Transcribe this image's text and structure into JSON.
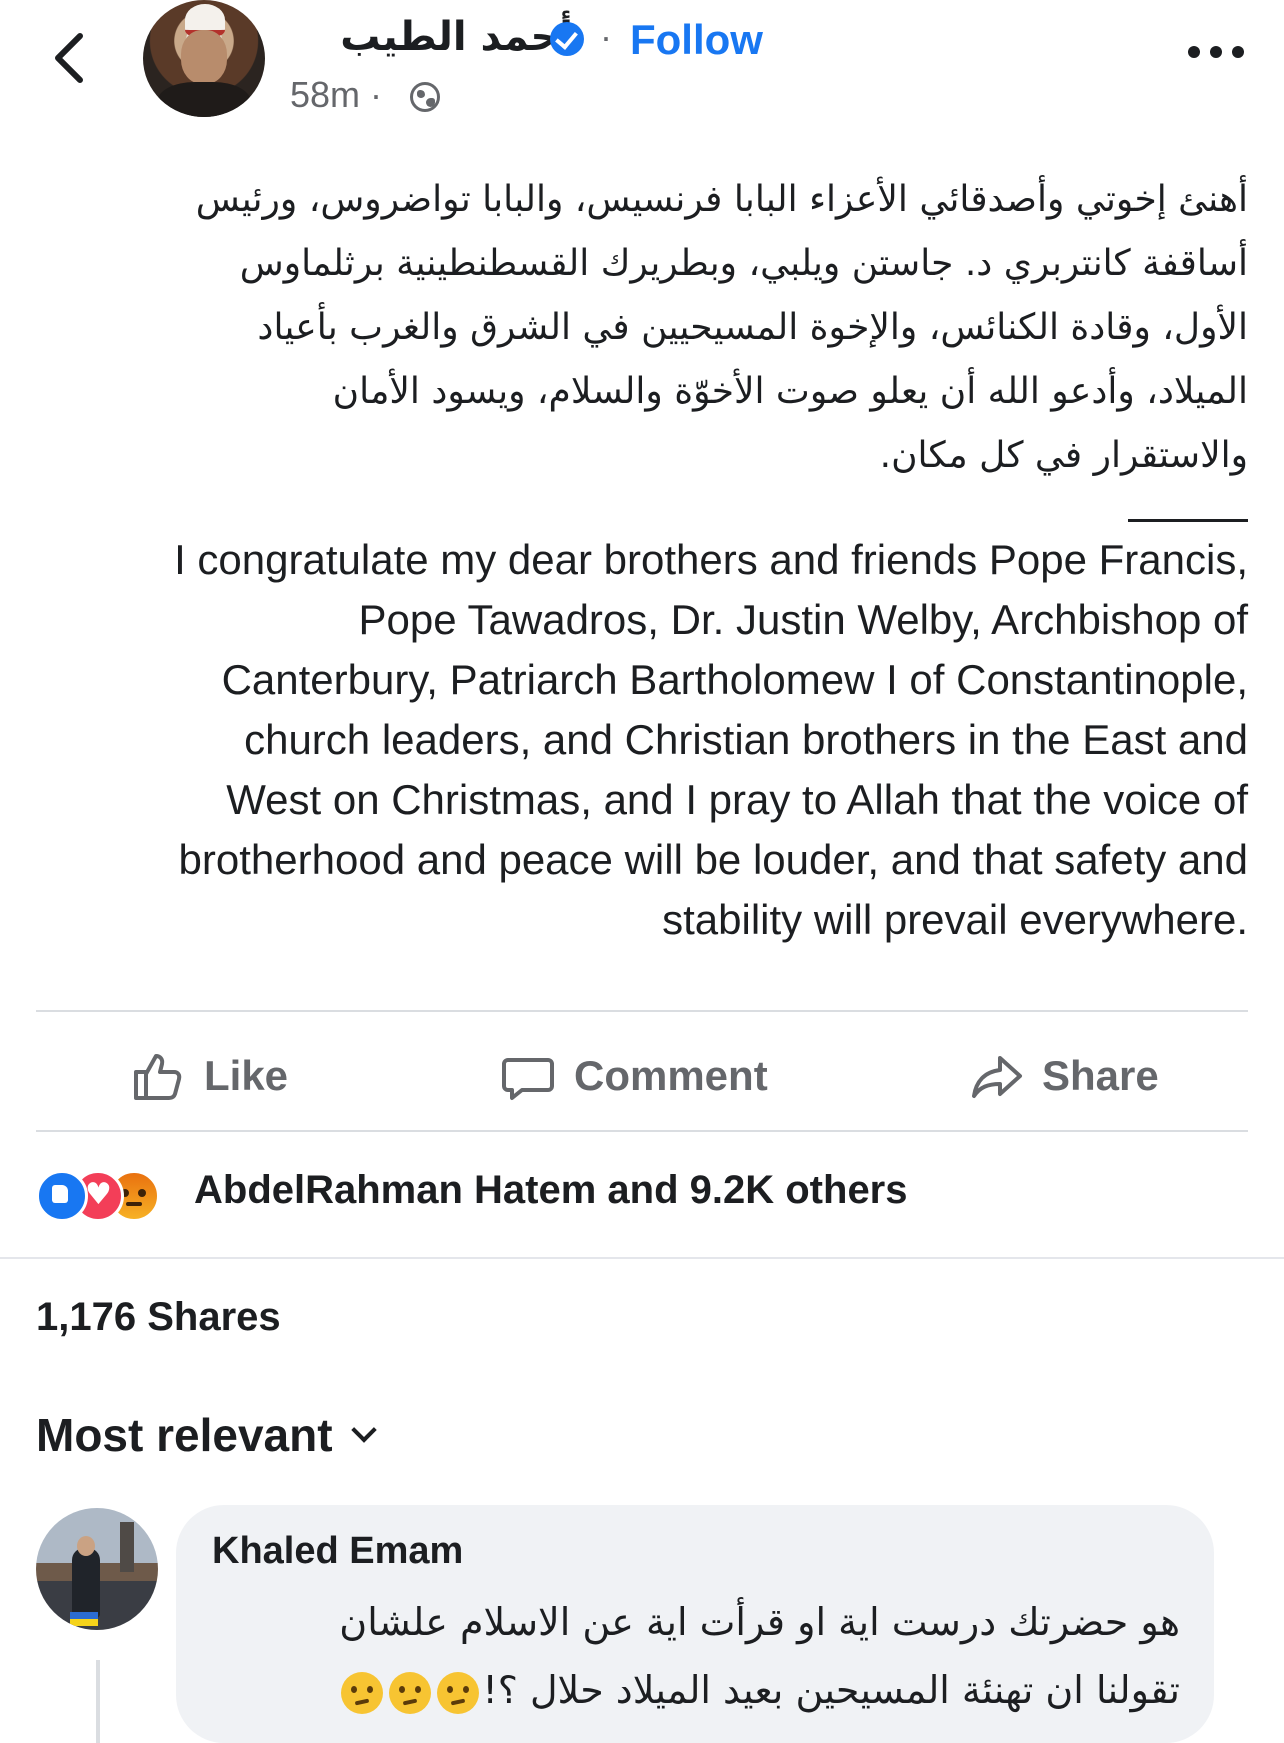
{
  "post": {
    "author": "أحمد الطيب",
    "verified": true,
    "follow_label": "Follow",
    "separator": "·",
    "time": "58m",
    "audience_icon": "globe-icon",
    "body_arabic": "أهنئ إخوتي وأصدقائي الأعزاء البابا فرنسيس، والبابا تواضروس، ورئيس\nأساقفة كانتربري د. جاستن ويلبي، وبطريرك القسطنطينية برثلماوس\nالأول، وقادة الكنائس، والإخوة المسيحيين في الشرق والغرب بأعياد\nالميلاد، وأدعو الله أن يعلو صوت الأخوّة والسلام، ويسود الأمان\nوالاستقرار في كل مكان.",
    "body_english": "I congratulate my dear brothers and friends Pope Francis,\nPope Tawadros, Dr. Justin Welby, Archbishop of\nCanterbury, Patriarch Bartholomew I of Constantinople,\nchurch leaders, and Christian brothers in the East and\nWest on Christmas, and I pray to Allah that the voice of\nbrotherhood and peace will be louder, and that safety and\nstability will prevail everywhere."
  },
  "actions": {
    "like_label": "Like",
    "comment_label": "Comment",
    "share_label": "Share"
  },
  "engagement": {
    "reaction_icons": [
      "like-icon",
      "love-icon",
      "angry-icon"
    ],
    "reactors_text": "AbdelRahman Hatem and 9.2K others",
    "shares_text": "1,176 Shares"
  },
  "comments": {
    "sort_label": "Most relevant",
    "items": [
      {
        "name": "Khaled Emam",
        "text": "هو حضرتك درست اية او قرأت اية عن الاسلام علشان\nتقولنا ان تهنئة المسيحين بعيد الميلاد حلال ؟!",
        "emoji_count": 3,
        "emoji_name": "thinking-face"
      }
    ]
  },
  "colors": {
    "brand_blue": "#1877f2",
    "muted_text": "#65676b",
    "text": "#1c1e21",
    "bubble": "#f0f2f5"
  }
}
